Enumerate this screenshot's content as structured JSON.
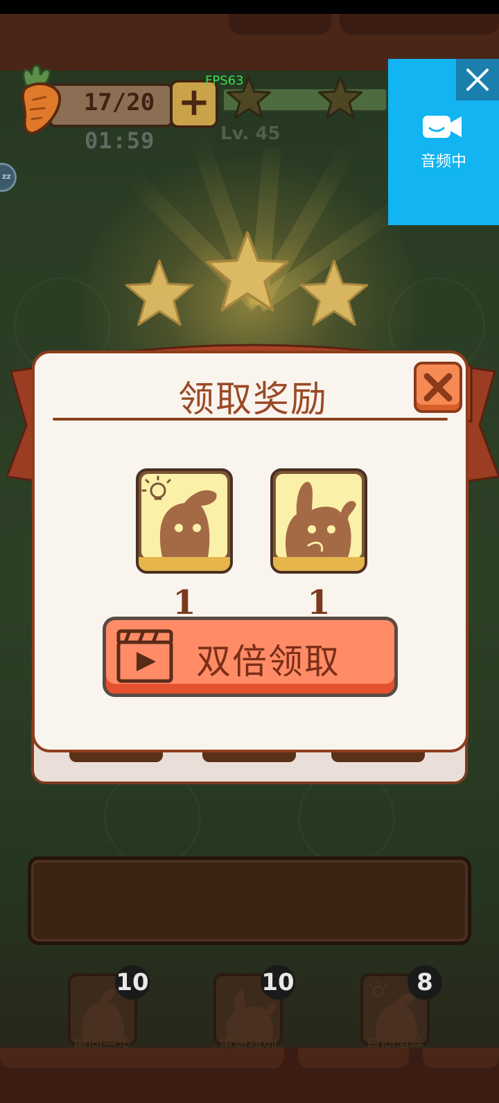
{
  "hud": {
    "energy": "17/20",
    "plus": "+",
    "timer": "01:59",
    "level": "Lv. 45",
    "fps": "FPS63",
    "side_badge": "zz"
  },
  "audio_overlay": {
    "label": "音频中",
    "close_icon": "close-icon",
    "camera_icon": "video-camera-icon",
    "color": "#12b4f2"
  },
  "dialog": {
    "title": "领取奖励",
    "rewards": [
      {
        "icon": "hint-bunny-icon",
        "count": "1"
      },
      {
        "icon": "shuffle-bunny-icon",
        "count": "1"
      }
    ],
    "double_button": "双倍领取",
    "close_icon": "close-x-icon"
  },
  "tools": [
    {
      "label": "撤回一步",
      "badge": "10",
      "icon": "undo-bunny-icon"
    },
    {
      "label": "重新排列",
      "badge": "10",
      "icon": "shuffle-bunny-icon"
    },
    {
      "label": "自动消除",
      "badge": "8",
      "icon": "auto-clear-bunny-icon"
    }
  ],
  "colors": {
    "dialog_bg": "#faf4ee",
    "dialog_border": "#8d3d1c",
    "title": "#9a4a26",
    "button": "#ff8c66",
    "star": "#d8b561"
  }
}
